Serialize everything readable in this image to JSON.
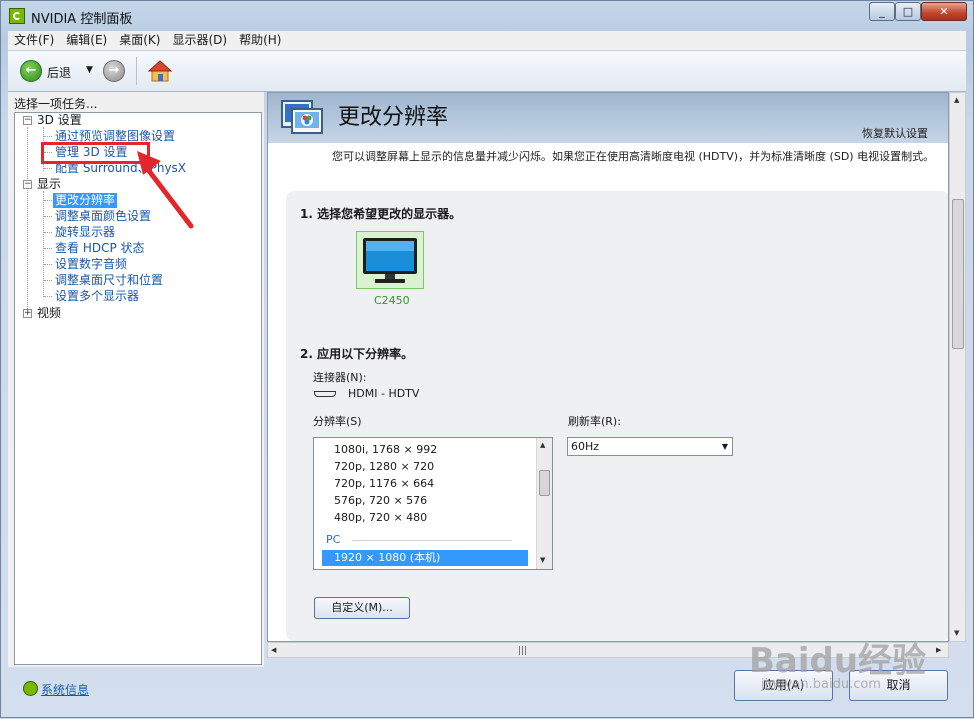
{
  "window": {
    "title": "NVIDIA 控制面板",
    "min": "_",
    "max": "□",
    "close": "✕"
  },
  "menu": [
    "文件(F)",
    "编辑(E)",
    "桌面(K)",
    "显示器(D)",
    "帮助(H)"
  ],
  "toolbar": {
    "back_label": "后退",
    "dropdown": "▼"
  },
  "left": {
    "title": "选择一项任务...",
    "cat_3d": "3D 设置",
    "item_preview": "通过预览调整图像设置",
    "item_manage3d": "管理 3D 设置",
    "item_surround": "配置 Surround、PhysX",
    "cat_display": "显示",
    "item_change_res": "更改分辨率",
    "item_desktop_color": "调整桌面颜色设置",
    "item_rotate": "旋转显示器",
    "item_hdcp": "查看 HDCP 状态",
    "item_audio": "设置数字音频",
    "item_desktop_size": "调整桌面尺寸和位置",
    "item_multi": "设置多个显示器",
    "cat_video": "视频",
    "expander_minus": "−",
    "expander_plus": "+"
  },
  "sysinfo": "系统信息",
  "main": {
    "title": "更改分辨率",
    "restore_defaults": "恢复默认设置",
    "description": "您可以调整屏幕上显示的信息量并减少闪烁。如果您正在使用高清晰度电视 (HDTV)，并为标准清晰度 (SD) 电视设置制式。",
    "step1": "1. 选择您希望更改的显示器。",
    "monitor_name": "C2450",
    "step2": "2. 应用以下分辨率。",
    "connector_label": "连接器(N):",
    "connector_value": "HDMI - HDTV",
    "resolution_label": "分辨率(S)",
    "refresh_label": "刷新率(R):",
    "refresh_value": "60Hz",
    "resolutions": [
      "1080i, 1768 × 992",
      "720p, 1280 × 720",
      "720p, 1176 × 664",
      "576p, 720 × 576",
      "480p, 720 × 480"
    ],
    "pc_group": "PC",
    "selected_resolution": "1920 × 1080 (本机)",
    "custom_button": "自定义(M)..."
  },
  "buttons": {
    "apply": "应用(A)",
    "cancel": "取消"
  },
  "watermark": {
    "brand": "Baidu经验",
    "url": "jingyan.baidu.com"
  },
  "colors": {
    "accent_red": "#e3262b",
    "nvidia_green": "#76b900",
    "selection_blue": "#3399ff"
  }
}
